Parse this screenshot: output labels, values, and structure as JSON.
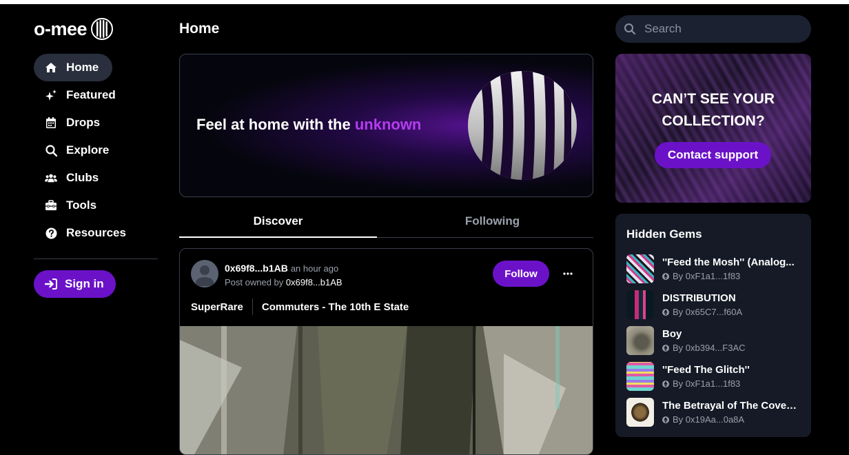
{
  "brand": {
    "name": "o-mee"
  },
  "nav": {
    "items": [
      {
        "label": "Home",
        "icon": "home-icon"
      },
      {
        "label": "Featured",
        "icon": "sparkle-icon"
      },
      {
        "label": "Drops",
        "icon": "calendar-icon"
      },
      {
        "label": "Explore",
        "icon": "search-icon"
      },
      {
        "label": "Clubs",
        "icon": "users-icon"
      },
      {
        "label": "Tools",
        "icon": "toolbox-icon"
      },
      {
        "label": "Resources",
        "icon": "help-icon"
      }
    ],
    "active": "Home",
    "signin_label": "Sign in"
  },
  "main": {
    "title": "Home",
    "hero": {
      "text": "Feel at home with the",
      "accent": "unknown"
    },
    "tabs": [
      {
        "label": "Discover"
      },
      {
        "label": "Following"
      }
    ],
    "post": {
      "author": "0x69f8...b1AB",
      "time": "an hour ago",
      "owned_prefix": "Post owned by",
      "owner": "0x69f8...b1AB",
      "follow_label": "Follow",
      "tags": [
        "SuperRare",
        "Commuters - The 10th E State"
      ]
    }
  },
  "search": {
    "placeholder": "Search"
  },
  "promo": {
    "title_line1": "CAN’T SEE YOUR",
    "title_line2": "COLLECTION?",
    "button": "Contact support"
  },
  "hidden_gems": {
    "title": "Hidden Gems",
    "items": [
      {
        "name": "''Feed the Mosh'' (Analog...",
        "by": "By 0xF1a1...1f83"
      },
      {
        "name": "DISTRIBUTION",
        "by": "By 0x65C7...f60A"
      },
      {
        "name": "Boy",
        "by": "By 0xb394...F3AC"
      },
      {
        "name": "''Feed The Glitch''",
        "by": "By 0xF1a1...1f83"
      },
      {
        "name": "The Betrayal of The Coven...",
        "by": "By 0x19Aa...0a8A"
      }
    ]
  },
  "colors": {
    "accent": "#6b12c9",
    "accent_text": "#b53cf0",
    "panel": "#151a26"
  }
}
